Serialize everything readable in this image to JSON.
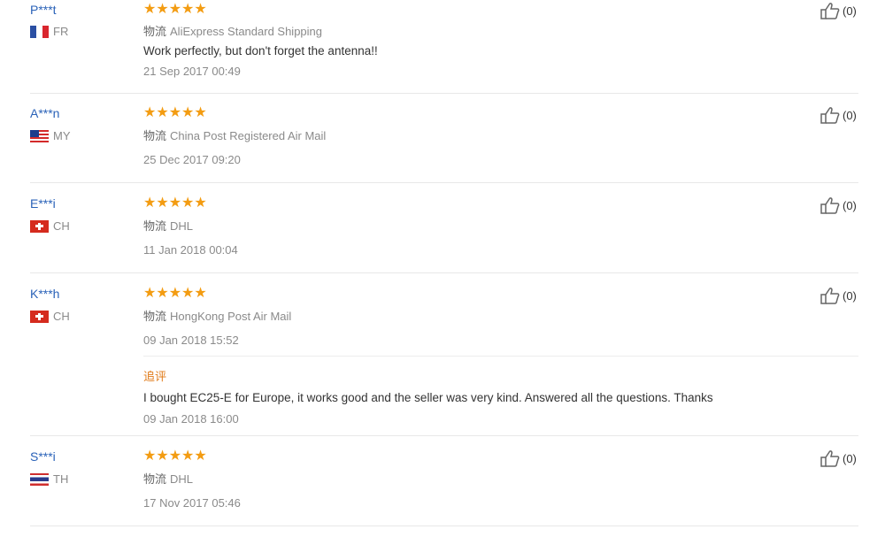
{
  "reviews": [
    {
      "user": "P***t",
      "country": "FR",
      "shipping_label": "物流",
      "shipping": "AliExpress Standard Shipping",
      "rating": 5,
      "stars": "★★★★★",
      "text": "Work perfectly, but don't forget the antenna!!",
      "date": "21 Sep 2017 00:49",
      "likes": "(0)"
    },
    {
      "user": "A***n",
      "country": "MY",
      "shipping_label": "物流",
      "shipping": "China Post Registered Air Mail",
      "rating": 5,
      "stars": "★★★★★",
      "date": "25 Dec 2017 09:20",
      "likes": "(0)"
    },
    {
      "user": "E***i",
      "country": "CH",
      "shipping_label": "物流",
      "shipping": "DHL",
      "rating": 5,
      "stars": "★★★★★",
      "date": "11 Jan 2018 00:04",
      "likes": "(0)"
    },
    {
      "user": "K***h",
      "country": "CH",
      "shipping_label": "物流",
      "shipping": "HongKong Post Air Mail",
      "rating": 5,
      "stars": "★★★★★",
      "date": "09 Jan 2018 15:52",
      "likes": "(0)",
      "followup": {
        "label": "追评",
        "text": "I bought EC25-E for Europe, it works good and the seller was very kind. Answered all the questions. Thanks",
        "date": "09 Jan 2018 16:00"
      }
    },
    {
      "user": "S***i",
      "country": "TH",
      "shipping_label": "物流",
      "shipping": "DHL",
      "rating": 5,
      "stars": "★★★★★",
      "date": "17 Nov 2017 05:46",
      "likes": "(0)"
    }
  ],
  "colors": {
    "username": "#2a62b8",
    "stars": "#f39c12",
    "followup_label": "#e07b1a",
    "muted": "#8a8a8a"
  },
  "icons": {
    "like": "thumbs-up-icon"
  }
}
